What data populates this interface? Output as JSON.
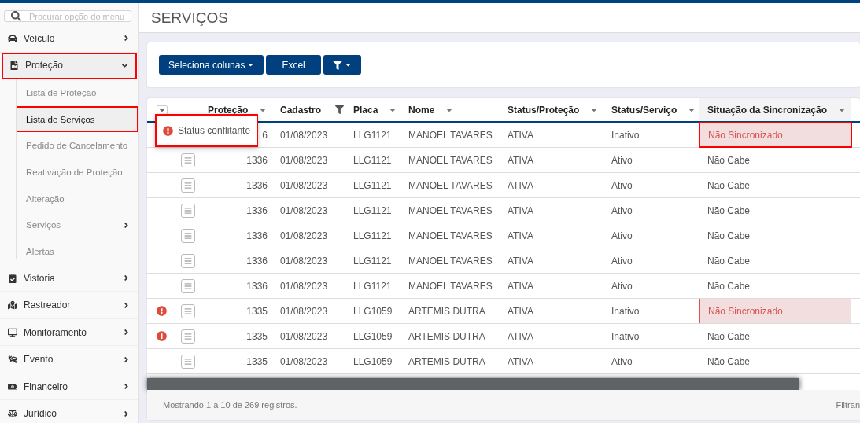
{
  "sidebar": {
    "search": {
      "placeholder": "Procurar opção do menu"
    },
    "items": [
      {
        "label": "Veículo",
        "expanded": false,
        "highlighted": false
      },
      {
        "label": "Proteção",
        "expanded": true,
        "highlighted": true,
        "children": [
          {
            "label": "Lista de Proteção",
            "selected": false,
            "highlighted": false
          },
          {
            "label": "Lista de Serviços",
            "selected": true,
            "highlighted": true
          },
          {
            "label": "Pedido de Cancelamento",
            "selected": false,
            "highlighted": false
          },
          {
            "label": "Reativação de Proteção",
            "selected": false,
            "highlighted": false
          },
          {
            "label": "Alteração",
            "selected": false,
            "highlighted": false
          },
          {
            "label": "Serviços",
            "selected": false,
            "highlighted": false,
            "expanded": false
          },
          {
            "label": "Alertas",
            "selected": false,
            "highlighted": false
          }
        ]
      },
      {
        "label": "Vistoria",
        "expanded": false,
        "highlighted": false
      },
      {
        "label": "Rastreador",
        "expanded": false,
        "highlighted": false
      },
      {
        "label": "Monitoramento",
        "expanded": false,
        "highlighted": false
      },
      {
        "label": "Evento",
        "expanded": false,
        "highlighted": false
      },
      {
        "label": "Financeiro",
        "expanded": false,
        "highlighted": false
      },
      {
        "label": "Jurídico",
        "expanded": false,
        "highlighted": false
      }
    ]
  },
  "page_title": "SERVIÇOS",
  "toolbar": {
    "buttons": [
      {
        "kind": "dropdown",
        "label": "Seleciona colunas"
      },
      {
        "kind": "plain",
        "label": "Excel"
      },
      {
        "kind": "filter"
      }
    ]
  },
  "table": {
    "columns": [
      {
        "label": "Proteção",
        "kind": "sort"
      },
      {
        "label": "Cadastro",
        "kind": "filter"
      },
      {
        "label": "Placa",
        "kind": "sort"
      },
      {
        "label": "Nome",
        "kind": "sort"
      },
      {
        "label": "Status/Proteção",
        "kind": "sort"
      },
      {
        "label": "Status/Serviço",
        "kind": "sort"
      },
      {
        "label": "Situação da Sincronização",
        "kind": "sort"
      }
    ],
    "tooltip": {
      "text": "Status conflitante",
      "highlighted": true
    },
    "rows": [
      {
        "conflict": false,
        "detail": false,
        "cells": [
          "6",
          "01/08/2023",
          "LLG1121",
          "MANOEL TAVARES",
          "ATIVA",
          "Inativo",
          "Não Sincronizado"
        ],
        "synced": false,
        "highlighted": true
      },
      {
        "conflict": false,
        "detail": true,
        "cells": [
          "1336",
          "01/08/2023",
          "LLG1121",
          "MANOEL TAVARES",
          "ATIVA",
          "Ativo",
          "Não Cabe"
        ],
        "synced": true,
        "highlighted": false
      },
      {
        "conflict": false,
        "detail": true,
        "cells": [
          "1336",
          "01/08/2023",
          "LLG1121",
          "MANOEL TAVARES",
          "ATIVA",
          "Ativo",
          "Não Cabe"
        ],
        "synced": true,
        "highlighted": false
      },
      {
        "conflict": false,
        "detail": true,
        "cells": [
          "1336",
          "01/08/2023",
          "LLG1121",
          "MANOEL TAVARES",
          "ATIVA",
          "Ativo",
          "Não Cabe"
        ],
        "synced": true,
        "highlighted": false
      },
      {
        "conflict": false,
        "detail": true,
        "cells": [
          "1336",
          "01/08/2023",
          "LLG1121",
          "MANOEL TAVARES",
          "ATIVA",
          "Ativo",
          "Não Cabe"
        ],
        "synced": true,
        "highlighted": false
      },
      {
        "conflict": false,
        "detail": true,
        "cells": [
          "1336",
          "01/08/2023",
          "LLG1121",
          "MANOEL TAVARES",
          "ATIVA",
          "Ativo",
          "Não Cabe"
        ],
        "synced": true,
        "highlighted": false
      },
      {
        "conflict": false,
        "detail": true,
        "cells": [
          "1336",
          "01/08/2023",
          "LLG1121",
          "MANOEL TAVARES",
          "ATIVA",
          "Ativo",
          "Não Cabe"
        ],
        "synced": true,
        "highlighted": false
      },
      {
        "conflict": true,
        "detail": true,
        "cells": [
          "1335",
          "01/08/2023",
          "LLG1059",
          "ARTEMIS DUTRA",
          "ATIVA",
          "Inativo",
          "Não Sincronizado"
        ],
        "synced": false,
        "highlighted": false
      },
      {
        "conflict": true,
        "detail": true,
        "cells": [
          "1335",
          "01/08/2023",
          "LLG1059",
          "ARTEMIS DUTRA",
          "ATIVA",
          "Inativo",
          "Não Cabe"
        ],
        "synced": true,
        "highlighted": false
      },
      {
        "conflict": false,
        "detail": true,
        "cells": [
          "1335",
          "01/08/2023",
          "LLG1059",
          "ARTEMIS DUTRA",
          "ATIVA",
          "Ativo",
          "Não Cabe"
        ],
        "synced": true,
        "highlighted": false
      }
    ],
    "footer": {
      "info": "Mostrando 1 a 10 de 269 registros.",
      "right": "Filtran"
    }
  }
}
